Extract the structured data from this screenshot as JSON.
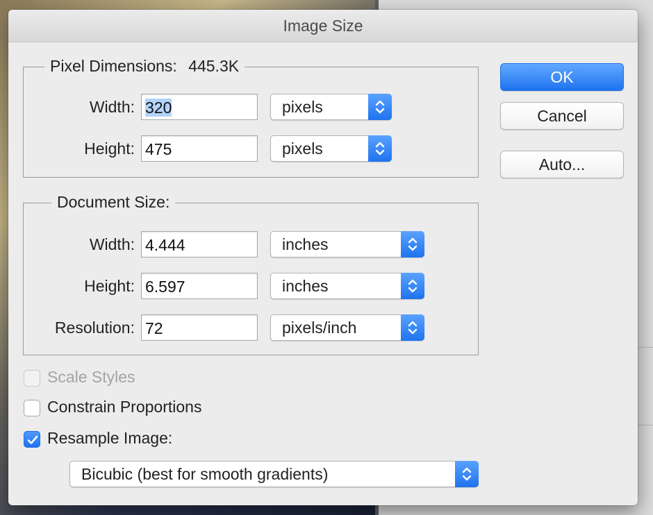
{
  "dialog": {
    "title": "Image Size"
  },
  "pixel_dimensions": {
    "legend": "Pixel Dimensions:",
    "size": "445.3K",
    "width": {
      "label": "Width:",
      "value": "320",
      "unit": "pixels"
    },
    "height": {
      "label": "Height:",
      "value": "475",
      "unit": "pixels"
    }
  },
  "document_size": {
    "legend": "Document Size:",
    "width": {
      "label": "Width:",
      "value": "4.444",
      "unit": "inches"
    },
    "height": {
      "label": "Height:",
      "value": "6.597",
      "unit": "inches"
    },
    "resolution": {
      "label": "Resolution:",
      "value": "72",
      "unit": "pixels/inch"
    }
  },
  "buttons": {
    "ok": "OK",
    "cancel": "Cancel",
    "auto": "Auto..."
  },
  "options": {
    "scale_styles": {
      "label": "Scale Styles",
      "checked": false,
      "enabled": false
    },
    "constrain_proportions": {
      "label": "Constrain Proportions",
      "checked": false,
      "enabled": true
    },
    "resample_image": {
      "label": "Resample Image:",
      "checked": true,
      "enabled": true
    }
  },
  "resample_method": {
    "value": "Bicubic (best for smooth gradients)"
  },
  "colors": {
    "accent": "#1f73ef",
    "selection": "#b3d3f8"
  },
  "icons": {
    "select_arrows": "updown-chevron-icon",
    "checkmark": "checkmark-icon"
  }
}
